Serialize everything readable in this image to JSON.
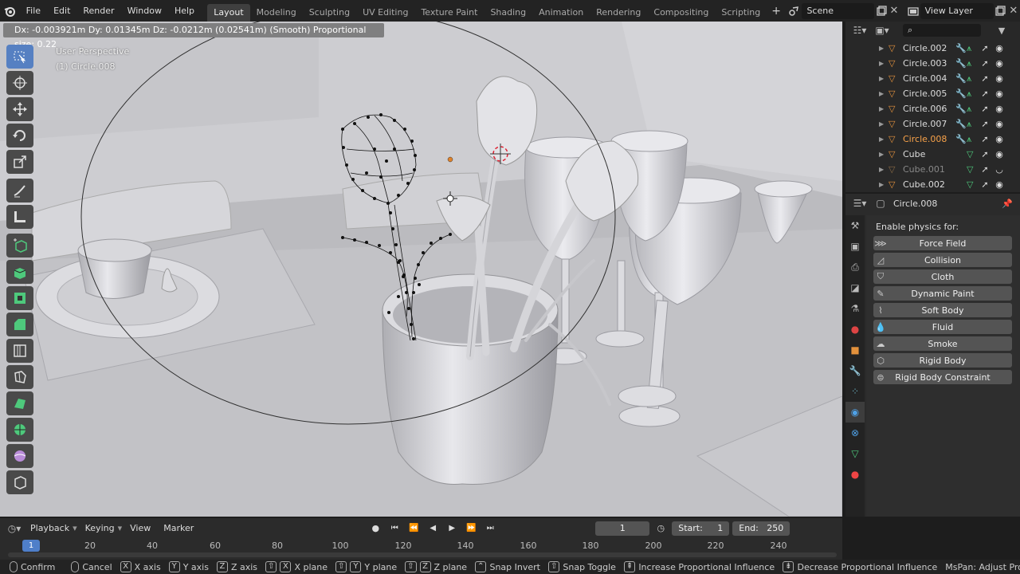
{
  "menubar": {
    "items": [
      "File",
      "Edit",
      "Render",
      "Window",
      "Help"
    ],
    "workspaces": [
      "Layout",
      "Modeling",
      "Sculpting",
      "UV Editing",
      "Texture Paint",
      "Shading",
      "Animation",
      "Rendering",
      "Compositing",
      "Scripting"
    ],
    "active_workspace": "Layout",
    "scene": "Scene",
    "view_layer": "View Layer"
  },
  "viewport": {
    "header_readout": "Dx: -0.003921m  Dy: 0.01345m  Dz: -0.0212m (0.02541m) (Smooth)   Proportional size: 0.22",
    "view_name": "User Perspective",
    "object_info": "(1) Circle.008"
  },
  "toolbar": {
    "tools": [
      "select-box-icon",
      "cursor-icon",
      "move-icon",
      "rotate-icon",
      "scale-icon",
      "annotate-icon",
      "measure-icon",
      "add-cube-icon",
      "extrude-icon",
      "inset-icon",
      "bevel-icon",
      "loop-cut-icon",
      "knife-icon",
      "poly-build-icon",
      "spin-icon",
      "smooth-icon",
      "shrink-icon"
    ],
    "active": "select-box-icon"
  },
  "outliner": {
    "items": [
      {
        "name": "Circle.002",
        "type": "curve",
        "state": "normal"
      },
      {
        "name": "Circle.003",
        "type": "curve",
        "state": "normal"
      },
      {
        "name": "Circle.004",
        "type": "curve",
        "state": "normal"
      },
      {
        "name": "Circle.005",
        "type": "curve",
        "state": "normal"
      },
      {
        "name": "Circle.006",
        "type": "curve",
        "state": "normal"
      },
      {
        "name": "Circle.007",
        "type": "curve",
        "state": "normal"
      },
      {
        "name": "Circle.008",
        "type": "curve",
        "state": "selected"
      },
      {
        "name": "Cube",
        "type": "mesh",
        "state": "normal"
      },
      {
        "name": "Cube.001",
        "type": "mesh",
        "state": "dim"
      },
      {
        "name": "Cube.002",
        "type": "mesh",
        "state": "normal"
      }
    ]
  },
  "properties": {
    "object_name": "Circle.008",
    "section_title": "Enable physics for:",
    "buttons": [
      "Force Field",
      "Collision",
      "Cloth",
      "Dynamic Paint",
      "Soft Body",
      "Fluid",
      "Smoke",
      "Rigid Body",
      "Rigid Body Constraint"
    ]
  },
  "timeline": {
    "menus": [
      "Playback",
      "Keying",
      "View",
      "Marker"
    ],
    "current_frame": "1",
    "start_label": "Start:",
    "start": "1",
    "end_label": "End:",
    "end": "250",
    "ticks": [
      "20",
      "40",
      "60",
      "80",
      "100",
      "120",
      "140",
      "160",
      "180",
      "200",
      "220",
      "240"
    ],
    "cursor_frame": "1"
  },
  "statusbar": {
    "items": [
      {
        "key": "mouse",
        "label": "Confirm"
      },
      {
        "key": "mouse",
        "label": "Cancel"
      },
      {
        "key": "X",
        "label": "X axis"
      },
      {
        "key": "Y",
        "label": "Y axis"
      },
      {
        "key": "Z",
        "label": "Z axis"
      },
      {
        "key": "X",
        "label": "X plane"
      },
      {
        "key": "Y",
        "label": "Y plane"
      },
      {
        "key": "Z",
        "label": "Z plane"
      },
      {
        "key": "",
        "label": "Snap Invert"
      },
      {
        "key": "",
        "label": "Snap Toggle"
      },
      {
        "key": "",
        "label": "Increase Proportional Influence"
      },
      {
        "key": "",
        "label": "Decrease Proportional Influence"
      },
      {
        "key": "",
        "label": "MsPan: Adjust Proportional Influ"
      }
    ]
  },
  "colors": {
    "accent": "#4f7fc9",
    "selected_text": "#f9a34a",
    "viewport_bg": "#c9c9cd"
  }
}
